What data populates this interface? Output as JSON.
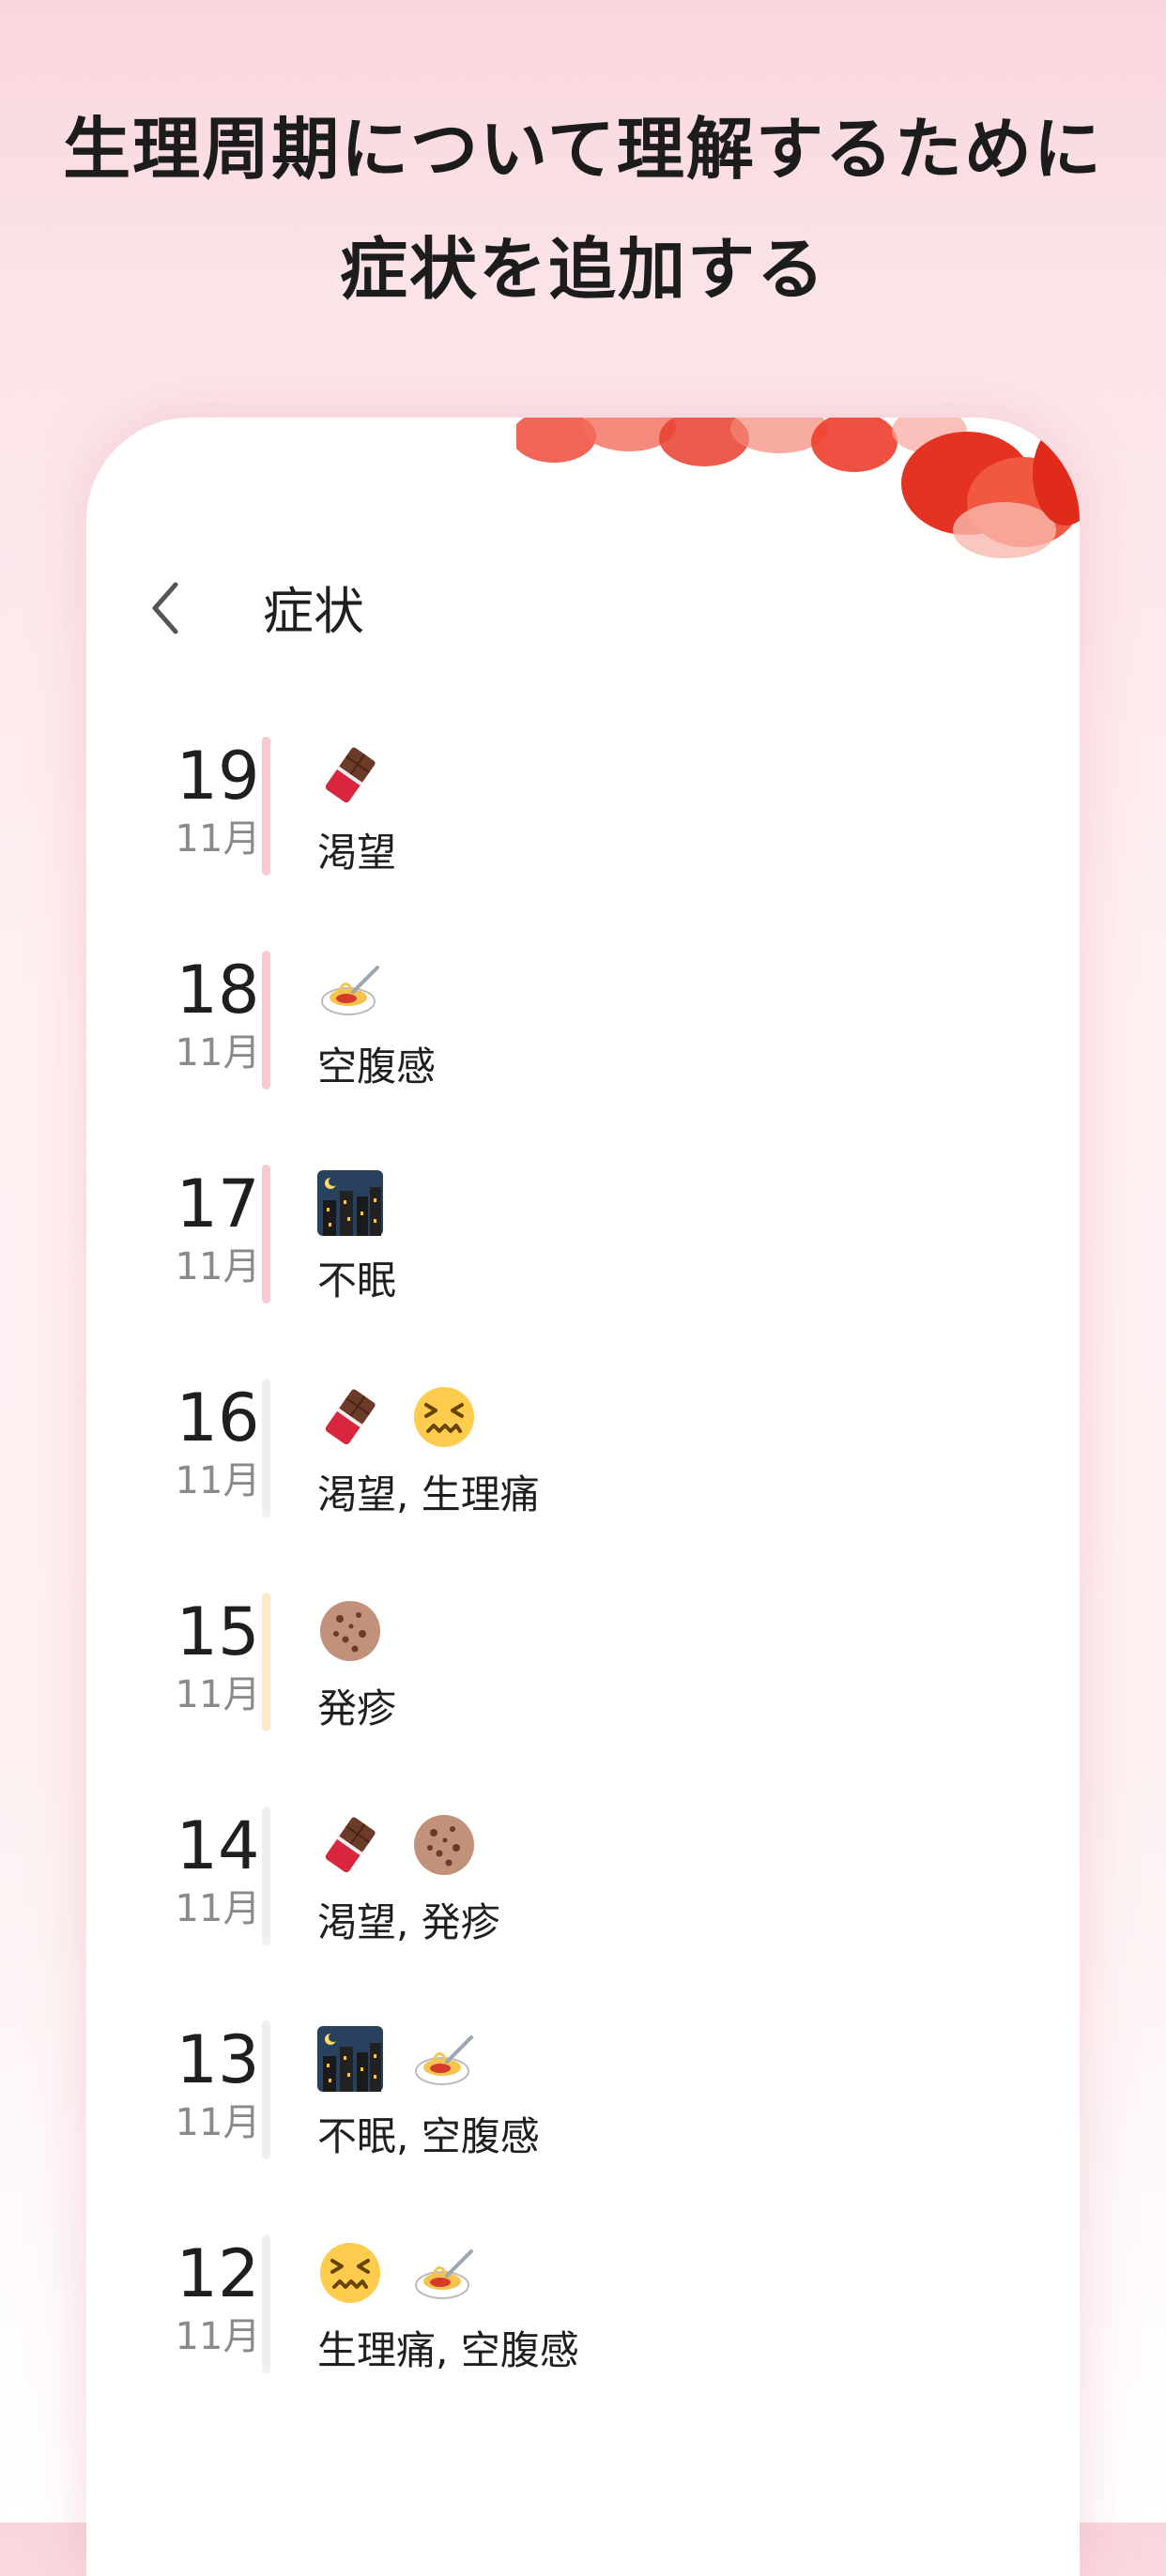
{
  "headline": {
    "line1": "生理周期について理解するために",
    "line2": "症状を追加する"
  },
  "nav": {
    "title": "症状"
  },
  "colors": {
    "bar_period": "#f9c9d1",
    "bar_neutral": "#efefef",
    "bar_ovulation": "#fde9c6"
  },
  "entries": [
    {
      "day": "19",
      "month": "11月",
      "icons": [
        "chocolate-icon"
      ],
      "symptoms": "渇望",
      "bar": "period"
    },
    {
      "day": "18",
      "month": "11月",
      "icons": [
        "spaghetti-icon"
      ],
      "symptoms": "空腹感",
      "bar": "period"
    },
    {
      "day": "17",
      "month": "11月",
      "icons": [
        "night-city-icon"
      ],
      "symptoms": "不眠",
      "bar": "period"
    },
    {
      "day": "16",
      "month": "11月",
      "icons": [
        "chocolate-icon",
        "confounded-face-icon"
      ],
      "symptoms": "渇望, 生理痛",
      "bar": "neutral"
    },
    {
      "day": "15",
      "month": "11月",
      "icons": [
        "cookie-icon"
      ],
      "symptoms": "発疹",
      "bar": "ovulation"
    },
    {
      "day": "14",
      "month": "11月",
      "icons": [
        "chocolate-icon",
        "cookie-icon"
      ],
      "symptoms": "渇望, 発疹",
      "bar": "neutral"
    },
    {
      "day": "13",
      "month": "11月",
      "icons": [
        "night-city-icon",
        "spaghetti-icon"
      ],
      "symptoms": "不眠, 空腹感",
      "bar": "neutral"
    },
    {
      "day": "12",
      "month": "11月",
      "icons": [
        "confounded-face-icon",
        "spaghetti-icon"
      ],
      "symptoms": "生理痛, 空腹感",
      "bar": "neutral"
    }
  ]
}
